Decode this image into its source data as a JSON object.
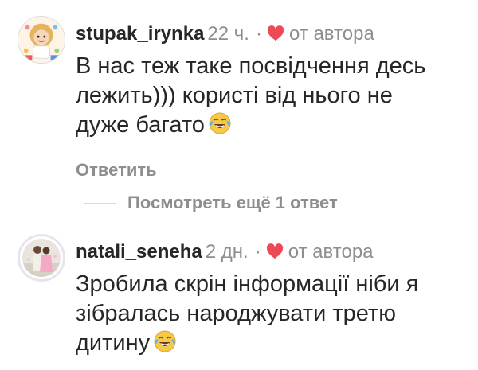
{
  "comments": [
    {
      "username": "stupak_irynka",
      "time": "22 ч.",
      "separator": "·",
      "author_liked_label": "от автора",
      "text": "В нас теж таке посвідчення десь лежить))) користі від нього не дуже багато",
      "emoji": "face-with-tears-of-joy-icon",
      "reply_label": "Ответить",
      "view_replies_label": "Посмотреть ещё 1 ответ"
    },
    {
      "username": "natali_seneha",
      "time": "2 дн.",
      "separator": "·",
      "author_liked_label": "от автора",
      "text": "Зробила скрін інформації  ніби я зібралась народжувати третю дитину",
      "emoji": "face-with-tears-of-joy-icon"
    }
  ],
  "colors": {
    "heart": "#ed4956",
    "muted": "#8e8e8e",
    "text": "#262626"
  }
}
